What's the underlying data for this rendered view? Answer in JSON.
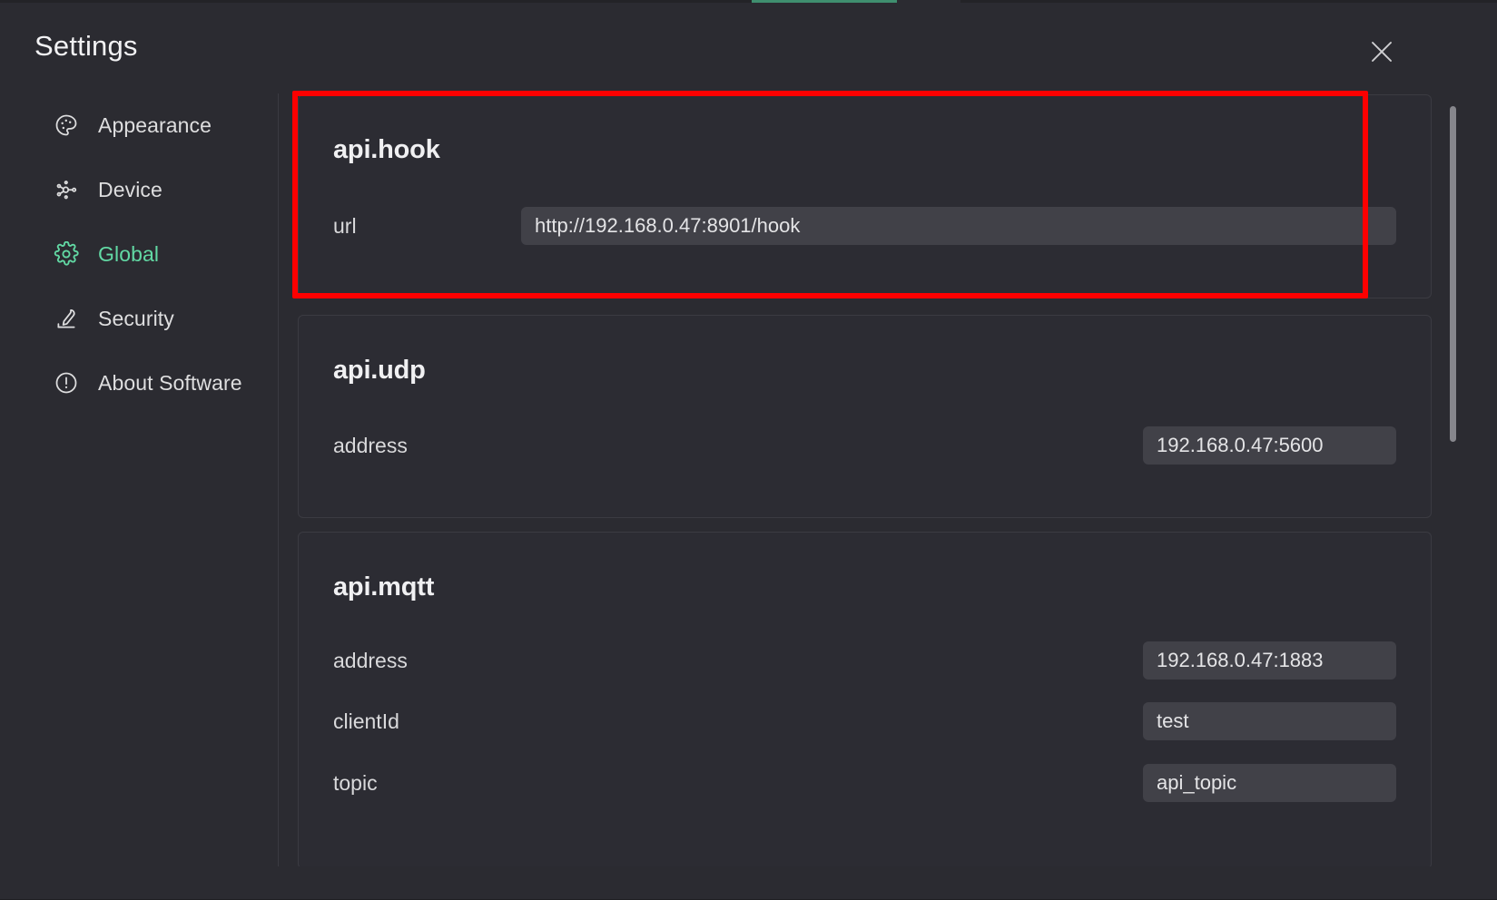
{
  "window": {
    "title": "Settings",
    "close_icon": "close-icon"
  },
  "colors": {
    "accent_green": "#62d9a4",
    "highlight_red": "#fe0000",
    "page_bg": "#2b2b31",
    "card_bg": "#2c2c33",
    "input_bg": "#414148",
    "text": "#e8e8ea"
  },
  "sidebar": {
    "items": [
      {
        "label": "Appearance",
        "icon": "palette-icon",
        "active": false
      },
      {
        "label": "Device",
        "icon": "device-nodes-icon",
        "active": false
      },
      {
        "label": "Global",
        "icon": "gear-icon",
        "active": true
      },
      {
        "label": "Security",
        "icon": "fingerprint-scan-icon",
        "active": false
      },
      {
        "label": "About Software",
        "icon": "info-circle-icon",
        "active": false
      }
    ]
  },
  "content": {
    "sections": [
      {
        "title": "api.hook",
        "fields": [
          {
            "label": "url",
            "value": "http://192.168.0.47:8901/hook",
            "placeholder": "",
            "width": "wide"
          }
        ]
      },
      {
        "title": "api.udp",
        "fields": [
          {
            "label": "address",
            "value": "192.168.0.47:5600",
            "placeholder": "",
            "width": "narrow"
          }
        ]
      },
      {
        "title": "api.mqtt",
        "fields": [
          {
            "label": "address",
            "value": "192.168.0.47:1883",
            "placeholder": "",
            "width": "narrow"
          },
          {
            "label": "clientId",
            "value": "test",
            "placeholder": "",
            "width": "narrow"
          },
          {
            "label": "topic",
            "value": "api_topic",
            "placeholder": "",
            "width": "narrow"
          }
        ]
      }
    ]
  },
  "scrollbar": {
    "orientation": "vertical",
    "thumb_position": "top"
  }
}
